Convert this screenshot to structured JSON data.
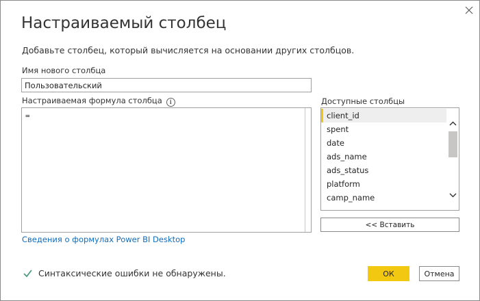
{
  "dialog": {
    "title": "Настраиваемый столбец",
    "subtitle": "Добавьте столбец, который вычисляется на основании других столбцов.",
    "close_icon": "close-icon"
  },
  "new_column": {
    "label": "Имя нового столбца",
    "value": "Пользовательский"
  },
  "formula": {
    "label": "Настраиваемая формула столбца",
    "info_icon": "info-icon",
    "value": "="
  },
  "link_text": "Сведения о формулах Power BI Desktop",
  "available_columns": {
    "label": "Доступные столбцы",
    "items": [
      {
        "label": "client_id",
        "selected": true
      },
      {
        "label": "spent",
        "selected": false
      },
      {
        "label": "date",
        "selected": false
      },
      {
        "label": "ads_name",
        "selected": false
      },
      {
        "label": "ads_status",
        "selected": false
      },
      {
        "label": "platform",
        "selected": false
      },
      {
        "label": "camp_name",
        "selected": false
      },
      {
        "label": "",
        "selected": false
      }
    ],
    "insert_label": "<< Вставить"
  },
  "status": {
    "icon": "checkmark-icon",
    "text": "Синтаксические ошибки не обнаружены."
  },
  "buttons": {
    "ok_label": "ОК",
    "cancel_label": "Отмена"
  },
  "colors": {
    "accent": "#f2c811",
    "link": "#0f6cbd",
    "check": "#4a9b7c"
  }
}
